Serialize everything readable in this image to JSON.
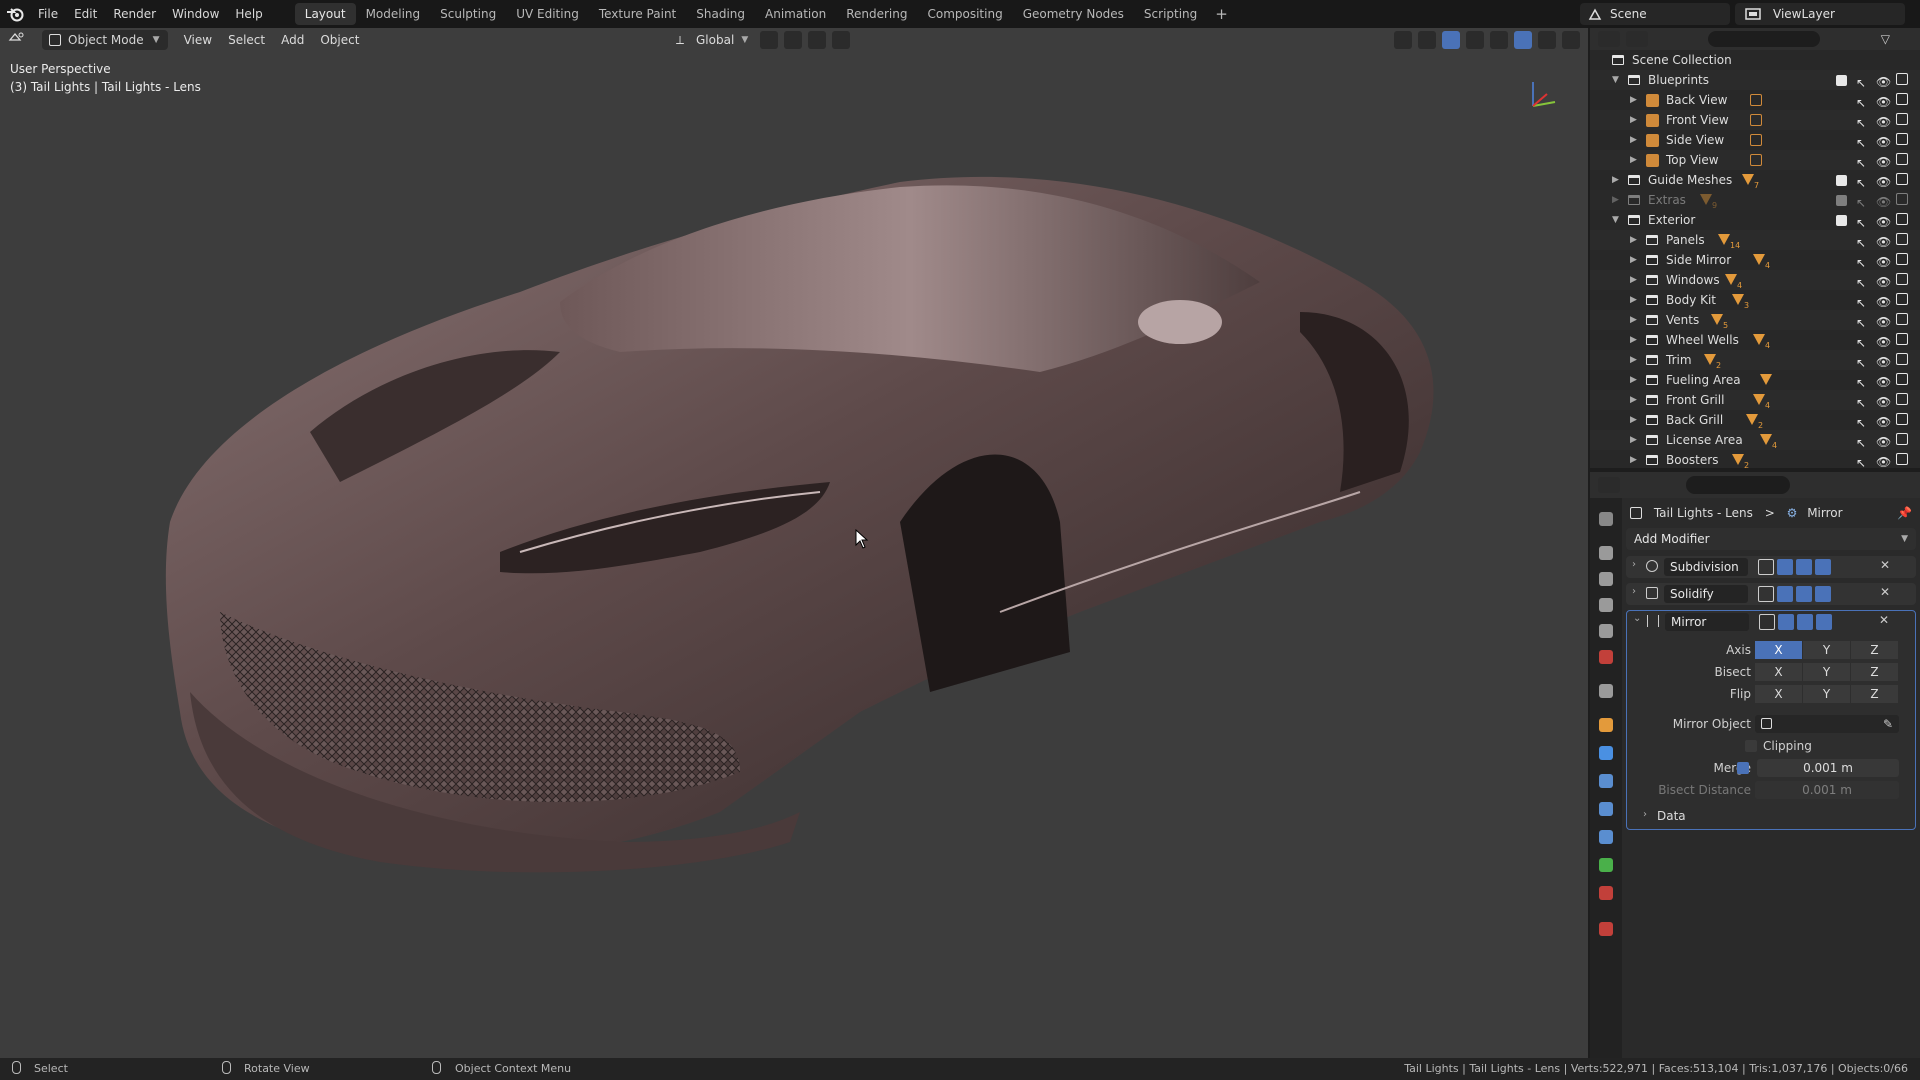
{
  "topbar": {
    "menus": [
      "File",
      "Edit",
      "Render",
      "Window",
      "Help"
    ],
    "workspaces": [
      "Layout",
      "Modeling",
      "Sculpting",
      "UV Editing",
      "Texture Paint",
      "Shading",
      "Animation",
      "Rendering",
      "Compositing",
      "Geometry Nodes",
      "Scripting"
    ],
    "active_workspace": "Layout",
    "add_tab": "+",
    "scene": "Scene",
    "view_layer": "ViewLayer"
  },
  "viewport": {
    "mode": "Object Mode",
    "menus": [
      "View",
      "Select",
      "Add",
      "Object"
    ],
    "orientation": "Global",
    "perspective": "User Perspective",
    "object_info": "(3) Tail Lights | Tail Lights - Lens",
    "car_color": "#5a4646"
  },
  "outliner": {
    "root": "Scene Collection",
    "rows": [
      {
        "label": "Blueprints",
        "depth": 1,
        "open": true,
        "kind": "collection"
      },
      {
        "label": "Back View",
        "depth": 2,
        "kind": "image"
      },
      {
        "label": "Front View",
        "depth": 2,
        "kind": "image"
      },
      {
        "label": "Side View",
        "depth": 2,
        "kind": "image"
      },
      {
        "label": "Top View",
        "depth": 2,
        "kind": "image"
      },
      {
        "label": "Guide Meshes",
        "depth": 1,
        "kind": "collection",
        "count": "7"
      },
      {
        "label": "Extras",
        "depth": 1,
        "kind": "collection",
        "count": "9",
        "dim": true
      },
      {
        "label": "Exterior",
        "depth": 1,
        "open": true,
        "kind": "collection"
      },
      {
        "label": "Panels",
        "depth": 2,
        "kind": "collection",
        "count": "14"
      },
      {
        "label": "Side Mirror",
        "depth": 2,
        "kind": "collection",
        "count": "4"
      },
      {
        "label": "Windows",
        "depth": 2,
        "kind": "collection",
        "count": "4"
      },
      {
        "label": "Body Kit",
        "depth": 2,
        "kind": "collection",
        "count": "3"
      },
      {
        "label": "Vents",
        "depth": 2,
        "kind": "collection",
        "count": "5"
      },
      {
        "label": "Wheel Wells",
        "depth": 2,
        "kind": "collection",
        "count": "4"
      },
      {
        "label": "Trim",
        "depth": 2,
        "kind": "collection",
        "count": "2"
      },
      {
        "label": "Fueling Area",
        "depth": 2,
        "kind": "collection",
        "count": ""
      },
      {
        "label": "Front Grill",
        "depth": 2,
        "kind": "collection",
        "count": "4"
      },
      {
        "label": "Back Grill",
        "depth": 2,
        "kind": "collection",
        "count": "2"
      },
      {
        "label": "License Area",
        "depth": 2,
        "kind": "collection",
        "count": "4"
      },
      {
        "label": "Boosters",
        "depth": 2,
        "kind": "collection",
        "count": "2"
      }
    ]
  },
  "properties": {
    "breadcrumb_object": "Tail Lights - Lens",
    "breadcrumb_sep": ">",
    "breadcrumb_modifier": "Mirror",
    "add_modifier": "Add Modifier",
    "modifiers": [
      {
        "name": "Subdivision"
      },
      {
        "name": "Solidify"
      },
      {
        "name": "Mirror"
      }
    ],
    "mirror": {
      "axis_label": "Axis",
      "bisect_label": "Bisect",
      "flip_label": "Flip",
      "axes": [
        "X",
        "Y",
        "Z"
      ],
      "mirror_object_label": "Mirror Object",
      "clipping_label": "Clipping",
      "merge_label": "Merge",
      "merge_value": "0.001 m",
      "bisect_distance_label": "Bisect Distance",
      "bisect_distance_value": "0.001 m",
      "data_label": "Data"
    }
  },
  "statusbar": {
    "select": "Select",
    "rotate": "Rotate View",
    "context": "Object Context Menu",
    "stats": "Tail Lights | Tail Lights - Lens | Verts:522,971 | Faces:513,104 | Tris:1,037,176 | Objects:0/66"
  },
  "colors": {
    "accent": "#4a72b8",
    "collection_icon": "#e39a3b",
    "viewport_bg": "#3d3d3d"
  }
}
